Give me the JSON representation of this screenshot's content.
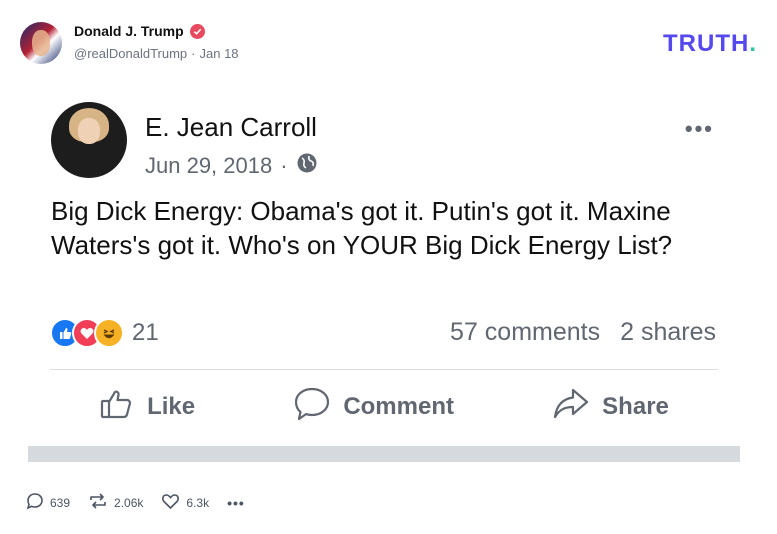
{
  "truth_post": {
    "author_name": "Donald J. Trump",
    "handle": "@realDonaldTrump",
    "separator": "·",
    "date": "Jan 18",
    "logo_text": "TRUTH",
    "logo_dot": ".",
    "icons": {
      "verified": "verified-badge-icon"
    },
    "colors": {
      "logo": "#5448ee",
      "logo_dot": "#2ec6a2",
      "verified": "#e84a5f"
    }
  },
  "embedded_post": {
    "author": "E. Jean Carroll",
    "date": "Jun 29, 2018",
    "separator": "·",
    "privacy_icon": "globe-icon",
    "more_label": "•••",
    "text": "Big Dick Energy: Obama's got it. Putin's got it. Maxine Waters's got it. Who's on YOUR Big Dick Energy List?",
    "reaction_count": "21",
    "comments": "57 comments",
    "shares": "2 shares",
    "actions": {
      "like": "Like",
      "comment": "Comment",
      "share": "Share"
    },
    "reactions": [
      "like",
      "love",
      "haha"
    ]
  },
  "footer": {
    "replies": "639",
    "retruths": "2.06k",
    "likes": "6.3k",
    "more": "•••"
  }
}
